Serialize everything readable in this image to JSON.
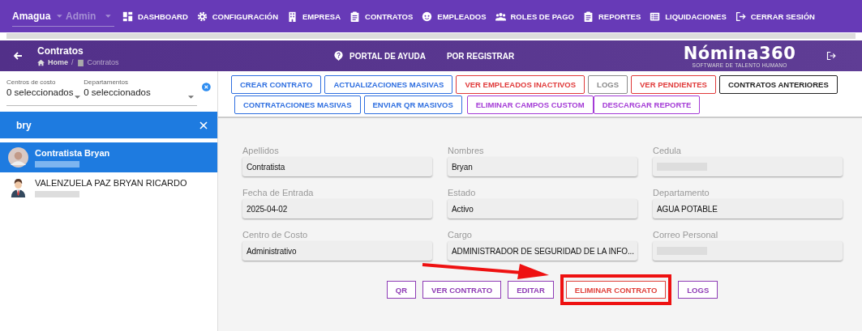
{
  "top_bar": {
    "company": "Amagua",
    "role": "Admin",
    "nav": [
      {
        "label": "DASHBOARD"
      },
      {
        "label": "CONFIGURACIÓN"
      },
      {
        "label": "EMPRESA"
      },
      {
        "label": "CONTRATOS"
      },
      {
        "label": "EMPLEADOS"
      },
      {
        "label": "ROLES DE PAGO"
      },
      {
        "label": "REPORTES"
      },
      {
        "label": "LIQUIDACIONES"
      },
      {
        "label": "CERRAR SESIÓN"
      }
    ]
  },
  "header": {
    "title": "Contratos",
    "breadcrumb": [
      "Home",
      "Contratos"
    ],
    "breadcrumb_separator": "/",
    "links": [
      "PORTAL DE AYUDA",
      "POR REGISTRAR"
    ],
    "logo": "Nómina360",
    "logo_tagline": "SOFTWARE DE TALENTO HUMANO"
  },
  "filters": [
    {
      "label": "Centros de costo",
      "value": "0 seleccionados"
    },
    {
      "label": "Departamentos",
      "value": "0 seleccionados"
    }
  ],
  "search": {
    "value": "bry"
  },
  "employees": [
    {
      "name": "Contratista Bryan",
      "selected": true
    },
    {
      "name": "VALENZUELA PAZ BRYAN RICARDO",
      "selected": false
    }
  ],
  "action_rows": [
    [
      {
        "label": "CREAR CONTRATO",
        "color": "#2f6fe0"
      },
      {
        "label": "ACTUALIZACIONES MASIVAS",
        "color": "#2f6fe0"
      },
      {
        "label": "VER EMPLEADOS INACTIVOS",
        "color": "#e03a3a"
      },
      {
        "label": "LOGS",
        "color": "#8a8a8a"
      },
      {
        "label": "VER PENDIENTES",
        "color": "#e03a3a"
      },
      {
        "label": "CONTRATOS ANTERIORES",
        "color": "#222222"
      }
    ],
    [
      {
        "label": "CONTRATACIONES MASIVAS",
        "color": "#2f6fe0"
      },
      {
        "label": "ENVIAR QR MASIVOS",
        "color": "#2f6fe0"
      },
      {
        "label": "ELIMINAR CAMPOS CUSTOM",
        "color": "#a43bd6"
      },
      {
        "label": "DESCARGAR REPORTE",
        "color": "#a43bd6"
      }
    ]
  ],
  "fields": [
    {
      "label": "Apellidos",
      "value": "Contratista"
    },
    {
      "label": "Nombres",
      "value": "Bryan"
    },
    {
      "label": "Cedula",
      "redacted": true
    },
    {
      "label": "Fecha de Entrada",
      "value": "2025-04-02"
    },
    {
      "label": "Estado",
      "value": "Activo"
    },
    {
      "label": "Departamento",
      "value": "AGUA POTABLE"
    },
    {
      "label": "Centro de Costo",
      "value": "Administrativo"
    },
    {
      "label": "Cargo",
      "value": "ADMINISTRADOR DE SEGURIDAD DE LA INFO..."
    },
    {
      "label": "Correo Personal",
      "redacted": true
    }
  ],
  "contract_buttons": [
    {
      "label": "QR",
      "color": "#8e3bb5",
      "highlighted": false
    },
    {
      "label": "VER CONTRATO",
      "color": "#8e3bb5",
      "highlighted": false
    },
    {
      "label": "EDITAR",
      "color": "#8e3bb5",
      "highlighted": false
    },
    {
      "label": "ELIMINAR CONTRATO",
      "color": "#e0403a",
      "highlighted": true
    },
    {
      "label": "LOGS",
      "color": "#8e3bb5",
      "highlighted": false
    }
  ],
  "annotations": [
    {
      "kind": "arrow"
    }
  ]
}
